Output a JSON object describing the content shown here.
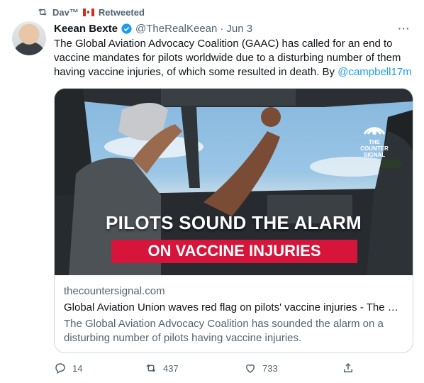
{
  "retweet_header": {
    "user": "Dav™",
    "label": "Retweeted",
    "icon": "retweet-icon"
  },
  "tweet": {
    "author_name": "Keean Bexte",
    "handle": "@TheRealKeean",
    "separator": "·",
    "date": "Jun 3",
    "more": "···",
    "text": "The Global Aviation Advocacy Coalition (GAAC) has called for an end to vaccine mandates for pilots worldwide due to a disturbing number of them having vaccine injuries, of which some resulted in death. By ",
    "mention": "@campbell17m"
  },
  "card": {
    "headline_top": "PILOTS SOUND THE ALARM",
    "headline_bottom": "ON VACCINE INJURIES",
    "brand_line1": "THE",
    "brand_line2": "COUNTER",
    "brand_line3": "SIGNAL",
    "domain": "thecountersignal.com",
    "title": "Global Aviation Union waves red flag on pilots' vaccine injuries - The C...",
    "description": "The Global Aviation Advocacy Coalition has sounded the alarm on a disturbing number of pilots having vaccine injuries."
  },
  "actions": {
    "replies": "14",
    "retweets": "437",
    "likes": "733"
  },
  "colors": {
    "accent": "#1d9bf0",
    "muted": "#536471",
    "banner_red": "#d7153a"
  }
}
